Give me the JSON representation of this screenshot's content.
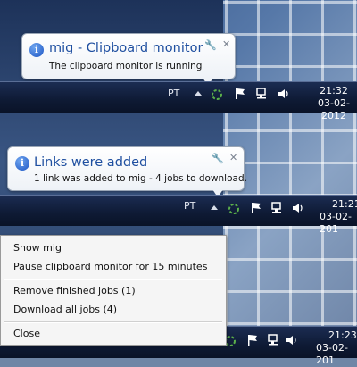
{
  "balloon1": {
    "title": "mig - Clipboard monitor",
    "text": "The clipboard monitor is running"
  },
  "balloon2": {
    "title": "Links were added",
    "text": "1 link was added to mig - 4 jobs to download."
  },
  "taskbar1": {
    "lang": "PT",
    "time": "21:32",
    "date": "03-02-2012"
  },
  "taskbar2": {
    "lang": "PT",
    "time": "21:21",
    "date": "03-02-201"
  },
  "taskbar3": {
    "time": "21:23",
    "date": "03-02-201"
  },
  "context_menu": {
    "items": [
      "Show mig",
      "Pause clipboard monitor for 15 minutes",
      "Remove finished jobs (1)",
      "Download all jobs (4)",
      "Close"
    ]
  },
  "icons": {
    "info": "info-icon",
    "pin": "pin-icon",
    "close": "close-icon",
    "app": "mig-tray-icon",
    "flag": "action-center-flag-icon",
    "network": "network-icon",
    "volume": "volume-icon",
    "chevron": "show-hidden-icons-chevron"
  },
  "colors": {
    "balloon_title": "#1f4fa0",
    "taskbar": "#0e1a34"
  }
}
